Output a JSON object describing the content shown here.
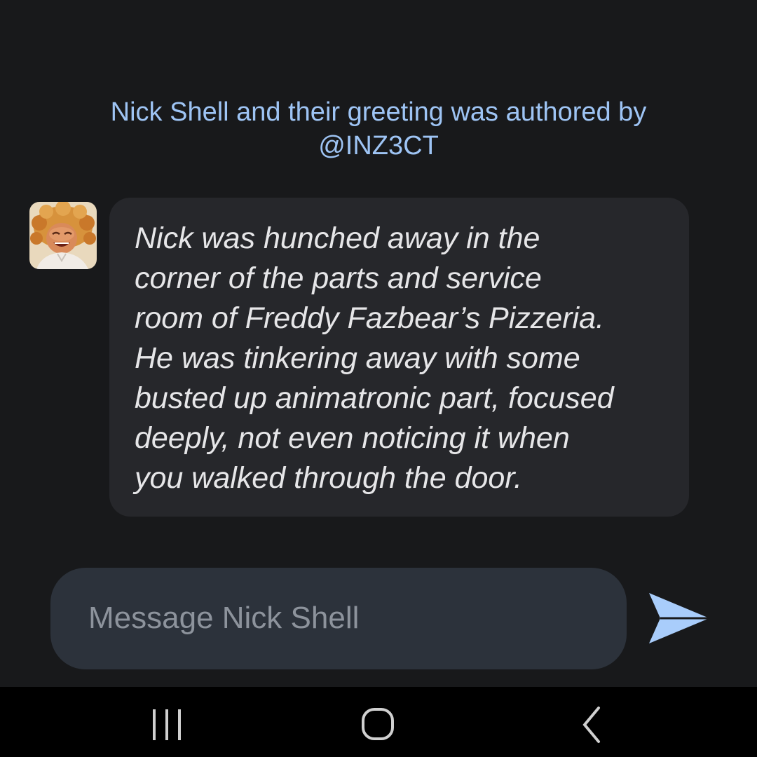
{
  "chat": {
    "attribution": "Nick Shell and their greeting was authored by\n@INZ3CT",
    "character_name": "Nick Shell",
    "greeting": "Nick was hunched away in the\ncorner of the parts and service\nroom of Freddy Fazbear’s Pizzeria.\nHe was tinkering away with some\nbusted up animatronic part, focused\ndeeply, not even noticing it when\nyou walked through the door."
  },
  "composer": {
    "placeholder": "Message Nick Shell",
    "value": ""
  },
  "icons": {
    "send": "send-arrow-icon",
    "nav_recents": "recent-apps-icon",
    "nav_home": "home-icon",
    "nav_back": "back-chevron-icon"
  },
  "colors": {
    "background": "#18191b",
    "accent": "#9ec4f4",
    "bubble": "#26272b",
    "composer": "#2c323b",
    "send": "#a9cdfb"
  }
}
